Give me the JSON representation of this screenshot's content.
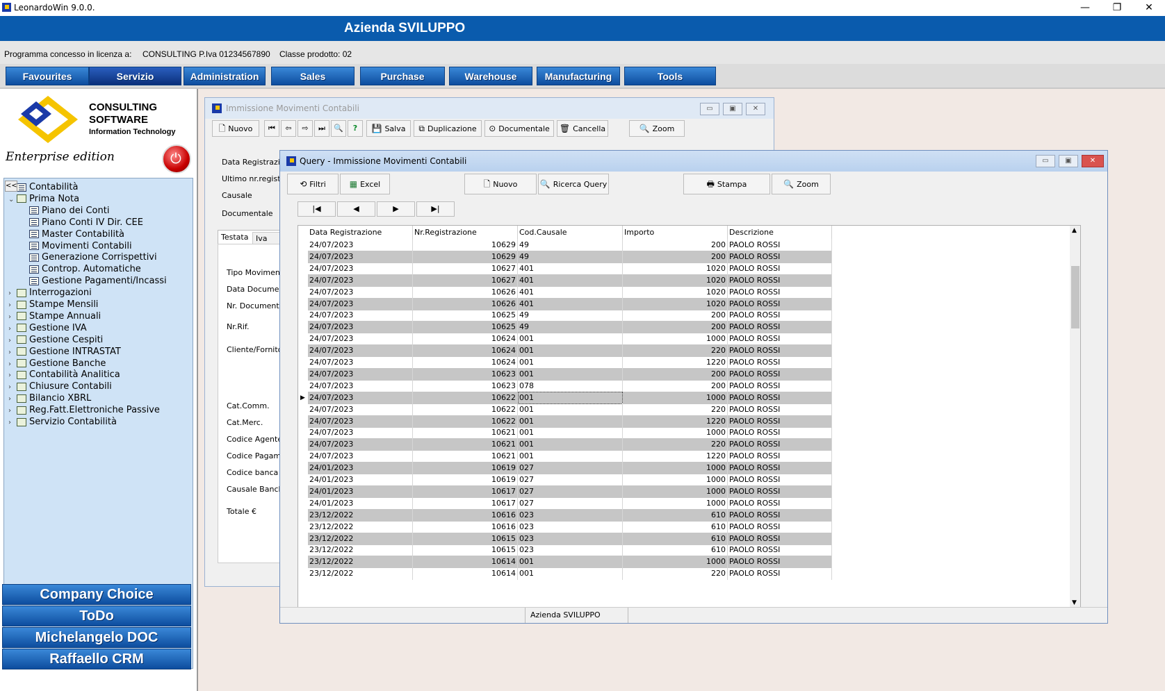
{
  "window": {
    "title": "LeonardoWin 9.0.0.",
    "controls": [
      "—",
      "❐",
      "✕"
    ]
  },
  "header": {
    "company": "Azienda SVILUPPO",
    "license_label": "Programma concesso in licenza a:",
    "license_holder": "CONSULTING P.Iva 01234567890",
    "product_class": "Classe prodotto: 02"
  },
  "menu": [
    "Favourites",
    "Servizio",
    "Administration",
    "Sales",
    "Purchase",
    "Warehouse",
    "Manufacturing",
    "Tools"
  ],
  "sidebar": {
    "logo_line1": "CONSULTING",
    "logo_line2": "SOFTWARE",
    "logo_line3": "Information Technology",
    "edition": "Enterprise edition",
    "collapse": "<<",
    "tree": [
      {
        "label": "Contabilità",
        "level": 0,
        "arrow": "",
        "icon": "book"
      },
      {
        "label": "Prima Nota",
        "level": 0,
        "arrow": "⌄",
        "icon": "folder"
      },
      {
        "label": "Piano dei Conti",
        "level": 1,
        "arrow": "",
        "icon": "book"
      },
      {
        "label": "Piano Conti IV Dir. CEE",
        "level": 1,
        "arrow": "",
        "icon": "book"
      },
      {
        "label": "Master Contabilità",
        "level": 1,
        "arrow": "",
        "icon": "book"
      },
      {
        "label": "Movimenti Contabili",
        "level": 1,
        "arrow": "",
        "icon": "book"
      },
      {
        "label": "Generazione Corrispettivi",
        "level": 1,
        "arrow": "",
        "icon": "book"
      },
      {
        "label": "Controp. Automatiche",
        "level": 1,
        "arrow": "",
        "icon": "book"
      },
      {
        "label": "Gestione Pagamenti/Incassi",
        "level": 1,
        "arrow": "",
        "icon": "book"
      },
      {
        "label": "Interrogazioni",
        "level": 0,
        "arrow": "›",
        "icon": "folder"
      },
      {
        "label": "Stampe Mensili",
        "level": 0,
        "arrow": "›",
        "icon": "folder"
      },
      {
        "label": "Stampe Annuali",
        "level": 0,
        "arrow": "›",
        "icon": "folder"
      },
      {
        "label": "Gestione IVA",
        "level": 0,
        "arrow": "›",
        "icon": "folder"
      },
      {
        "label": "Gestione Cespiti",
        "level": 0,
        "arrow": "›",
        "icon": "folder"
      },
      {
        "label": "Gestione INTRASTAT",
        "level": 0,
        "arrow": "›",
        "icon": "folder"
      },
      {
        "label": "Gestione Banche",
        "level": 0,
        "arrow": "›",
        "icon": "folder"
      },
      {
        "label": "Contabilità Analitica",
        "level": 0,
        "arrow": "›",
        "icon": "folder"
      },
      {
        "label": "Chiusure Contabili",
        "level": 0,
        "arrow": "›",
        "icon": "folder"
      },
      {
        "label": "Bilancio XBRL",
        "level": 0,
        "arrow": "›",
        "icon": "folder"
      },
      {
        "label": "Reg.Fatt.Elettroniche Passive",
        "level": 0,
        "arrow": "›",
        "icon": "folder"
      },
      {
        "label": "Servizio Contabilità",
        "level": 0,
        "arrow": "›",
        "icon": "folder"
      }
    ],
    "buttons": [
      "Company Choice",
      "ToDo",
      "Michelangelo DOC",
      "Raffaello CRM"
    ]
  },
  "win1": {
    "title": "Immissione Movimenti Contabili",
    "toolbar": {
      "nuovo": "Nuovo",
      "salva": "Salva",
      "duplicazione": "Duplicazione",
      "documentale": "Documentale",
      "cancella": "Cancella",
      "zoom": "Zoom",
      "help": "?"
    },
    "fields": [
      "Data Registrazion",
      "Ultimo nr.registr.",
      "Causale",
      "Documentale"
    ],
    "tabs": [
      "Testata",
      "Iva"
    ],
    "tab_fields": [
      "Tipo Movimento",
      "Data Documen",
      "Nr. Documento",
      "Nr.Rif.",
      "Cliente/Fornito",
      "Cat.Comm.",
      "Cat.Merc.",
      "Codice Agente",
      "Codice Pagame",
      "Codice banca",
      "Causale Banch",
      "Totale €"
    ]
  },
  "win2": {
    "title": "Query - Immissione Movimenti Contabili",
    "toolbar": {
      "filtri": "Filtri",
      "excel": "Excel",
      "nuovo": "Nuovo",
      "ricerca": "Ricerca Query",
      "stampa": "Stampa",
      "zoom": "Zoom"
    },
    "nav": [
      "|◀",
      "◀",
      "▶",
      "▶|"
    ],
    "columns": [
      "Data Registrazione",
      "Nr.Registrazione",
      "Cod.Causale",
      "Importo",
      "Descrizione"
    ],
    "selected_row": 13,
    "rows": [
      [
        "24/07/2023",
        "10629",
        "49",
        "200",
        "PAOLO ROSSI"
      ],
      [
        "24/07/2023",
        "10629",
        "49",
        "200",
        "PAOLO ROSSI"
      ],
      [
        "24/07/2023",
        "10627",
        "401",
        "1020",
        "PAOLO ROSSI"
      ],
      [
        "24/07/2023",
        "10627",
        "401",
        "1020",
        "PAOLO ROSSI"
      ],
      [
        "24/07/2023",
        "10626",
        "401",
        "1020",
        "PAOLO ROSSI"
      ],
      [
        "24/07/2023",
        "10626",
        "401",
        "1020",
        "PAOLO ROSSI"
      ],
      [
        "24/07/2023",
        "10625",
        "49",
        "200",
        "PAOLO ROSSI"
      ],
      [
        "24/07/2023",
        "10625",
        "49",
        "200",
        "PAOLO ROSSI"
      ],
      [
        "24/07/2023",
        "10624",
        "001",
        "1000",
        "PAOLO ROSSI"
      ],
      [
        "24/07/2023",
        "10624",
        "001",
        "220",
        "PAOLO ROSSI"
      ],
      [
        "24/07/2023",
        "10624",
        "001",
        "1220",
        "PAOLO ROSSI"
      ],
      [
        "24/07/2023",
        "10623",
        "001",
        "200",
        "PAOLO ROSSI"
      ],
      [
        "24/07/2023",
        "10623",
        "078",
        "200",
        "PAOLO ROSSI"
      ],
      [
        "24/07/2023",
        "10622",
        "001",
        "1000",
        "PAOLO ROSSI"
      ],
      [
        "24/07/2023",
        "10622",
        "001",
        "220",
        "PAOLO ROSSI"
      ],
      [
        "24/07/2023",
        "10622",
        "001",
        "1220",
        "PAOLO ROSSI"
      ],
      [
        "24/07/2023",
        "10621",
        "001",
        "1000",
        "PAOLO ROSSI"
      ],
      [
        "24/07/2023",
        "10621",
        "001",
        "220",
        "PAOLO ROSSI"
      ],
      [
        "24/07/2023",
        "10621",
        "001",
        "1220",
        "PAOLO ROSSI"
      ],
      [
        "24/01/2023",
        "10619",
        "027",
        "1000",
        "PAOLO ROSSI"
      ],
      [
        "24/01/2023",
        "10619",
        "027",
        "1000",
        "PAOLO ROSSI"
      ],
      [
        "24/01/2023",
        "10617",
        "027",
        "1000",
        "PAOLO ROSSI"
      ],
      [
        "24/01/2023",
        "10617",
        "027",
        "1000",
        "PAOLO ROSSI"
      ],
      [
        "23/12/2022",
        "10616",
        "023",
        "610",
        "PAOLO ROSSI"
      ],
      [
        "23/12/2022",
        "10616",
        "023",
        "610",
        "PAOLO ROSSI"
      ],
      [
        "23/12/2022",
        "10615",
        "023",
        "610",
        "PAOLO ROSSI"
      ],
      [
        "23/12/2022",
        "10615",
        "023",
        "610",
        "PAOLO ROSSI"
      ],
      [
        "23/12/2022",
        "10614",
        "001",
        "1000",
        "PAOLO ROSSI"
      ],
      [
        "23/12/2022",
        "10614",
        "001",
        "220",
        "PAOLO ROSSI"
      ]
    ],
    "status": "Azienda SVILUPPO"
  }
}
